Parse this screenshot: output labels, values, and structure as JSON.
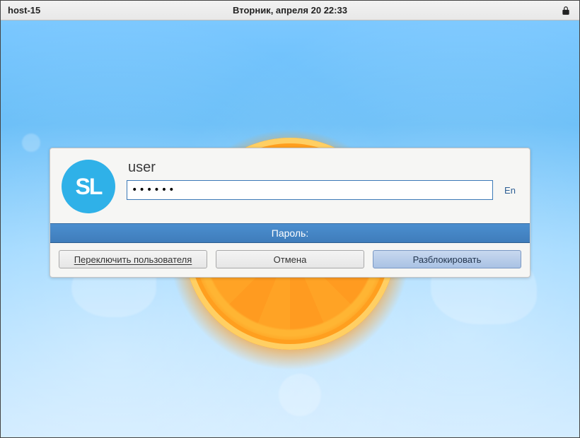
{
  "topbar": {
    "hostname": "host-15",
    "datetime": "Вторник, апреля 20   22:33"
  },
  "unlock": {
    "avatar_text": "SL",
    "username": "user",
    "password_value": "••••••",
    "keyboard_layout": "En",
    "prompt_label": "Пароль:",
    "switch_user_label": "Переключить пользователя",
    "cancel_label": "Отмена",
    "unlock_label": "Разблокировать"
  }
}
